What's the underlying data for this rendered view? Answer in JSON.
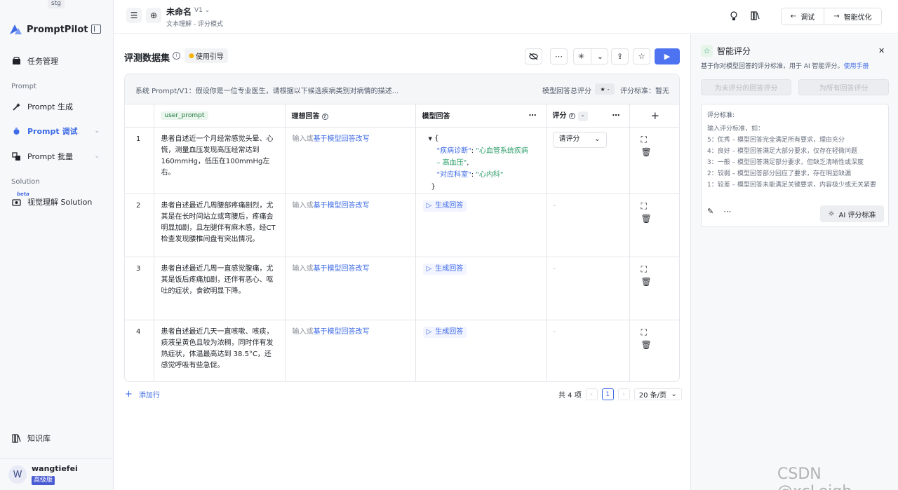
{
  "env": "stg",
  "brand": {
    "name": "PromptPilot"
  },
  "sidebar": {
    "items": [
      {
        "label": "任务管理",
        "icon": "task-icon"
      },
      {
        "label": "Prompt 生成",
        "icon": "magic-wand-icon"
      },
      {
        "label": "Prompt 调试",
        "icon": "debug-icon"
      },
      {
        "label": "Prompt 批量",
        "icon": "batch-icon"
      },
      {
        "label": "视觉理解 Solution",
        "icon": "vision-icon"
      },
      {
        "label": "知识库",
        "icon": "book-icon"
      }
    ],
    "sections": {
      "prompt": "Prompt",
      "solution": "Solution"
    },
    "beta_tag": "beta"
  },
  "user": {
    "avatar": "W",
    "name": "wangtiefei",
    "plan": "高级版"
  },
  "topbar": {
    "title": "未命名",
    "version": "V1",
    "subtitle": "文本理解 - 评分模式",
    "debug_label": "调试",
    "optimize_label": "智能优化"
  },
  "main": {
    "section_title": "评测数据集",
    "guide_label": "使用引导",
    "system_prompt": "系统 Prompt/V1：假设你是一位专业医生，请根据以下候选疾病类别对病情的描述...",
    "total_score_label": "模型回答总评分",
    "total_score_value": "-",
    "standard_label": "评分标准：暂无",
    "columns": {
      "user_prompt": "user_prompt",
      "ideal": "理想回答",
      "model": "模型回答",
      "score": "评分",
      "score_chip": "-"
    },
    "ideal_prefix": "输入或",
    "ideal_link": "基于模型回答改写",
    "generate_label": "生成回答",
    "score_placeholder": "请评分",
    "dash": "-",
    "rows": [
      {
        "index": "1",
        "prompt": "患者自述近一个月经常感觉头晕、心慌，测量血压发现高压经常达到160mmHg，低压在100mmHg左右。"
      },
      {
        "index": "2",
        "prompt": "患者自述最近几周腰部疼痛剧烈，尤其是在长时间站立或弯腰后，疼痛会明显加剧，且左腿伴有麻木感，经CT检查发现腰椎间盘有突出情况。"
      },
      {
        "index": "3",
        "prompt": "患者自述最近几周一直感觉腹痛，尤其是饭后疼痛加剧，还伴有恶心、呕吐的症状，食欲明显下降。"
      },
      {
        "index": "4",
        "prompt": "患者自述最近几天一直咳嗽、咳痰，痰液呈黄色且较为浓稠，同时伴有发热症状，体温最高达到 38.5°C，还感觉呼吸有些急促。"
      }
    ],
    "json_answer": {
      "open": "{",
      "k1": "\"疾病诊断\"",
      "v1a": "\"心血管系统疾病",
      "v1b": "– 高血压\"",
      "k2": "\"对应科室\"",
      "v2": "\"心内科\"",
      "close": "}"
    },
    "add_row": "添加行",
    "pager": {
      "total": "共 4 项",
      "current": "1",
      "size": "20 条/页"
    }
  },
  "panel": {
    "title": "智能评分",
    "desc": "基于你对模型回答的评分标准，用于 AI 智能评分。",
    "manual_link": "使用手册",
    "btn_unscored": "为未评分的回答评分",
    "btn_all": "为所有回答评分",
    "criteria_label": "评分标准:",
    "criteria_text": [
      "输入评分标准，如：",
      "5：优秀 – 模型回答完全满足所有要求，理由充分",
      "4：良好 – 模型回答满足大部分要求，仅存在轻微问题",
      "3：一般 – 模型回答满足部分要求，但缺乏清晰性或深度",
      "2：较弱 – 模型回答部分回应了要求，存在明显缺漏",
      "1：较差 – 模型回答未能满足关键要求，内容极少或无关紧要"
    ],
    "ai_btn": "AI 评分标准"
  },
  "watermark": "CSDN @xcLeigh"
}
